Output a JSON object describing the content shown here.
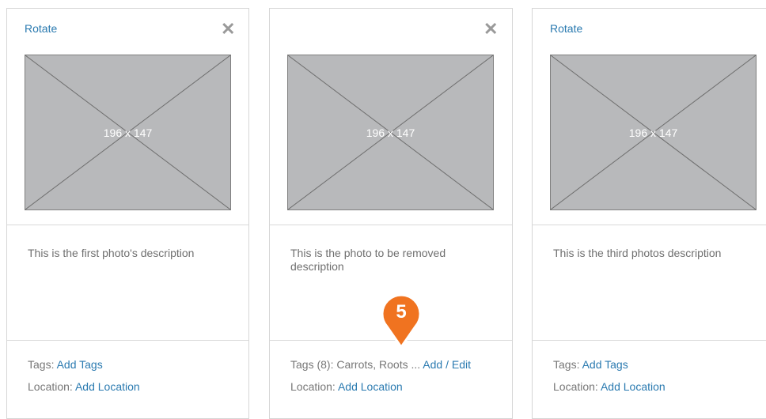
{
  "cards": [
    {
      "rotate_label": "Rotate",
      "close_glyph": "✕",
      "photo_label": "196 x 147",
      "description": "This is the first photo's description",
      "tags_label": "Tags:",
      "tags_link": "Add Tags",
      "location_label": "Location:",
      "location_link": "Add Location"
    },
    {
      "close_glyph": "✕",
      "photo_label": "196 x 147",
      "description": "This is the photo to be removed description",
      "tags_label": "Tags (8): Carrots, Roots ...",
      "tags_link": "Add / Edit",
      "location_label": "Location:",
      "location_link": "Add Location"
    },
    {
      "rotate_label": "Rotate",
      "photo_label": "196 x 147",
      "description": "This is the third photos description",
      "tags_label": "Tags:",
      "tags_link": "Add Tags",
      "location_label": "Location:",
      "location_link": "Add Location"
    }
  ],
  "annotation_marker": {
    "label": "5",
    "color": "#f07320"
  },
  "colors": {
    "link": "#2a7ab0",
    "placeholder": "#b8b9bb",
    "border": "#d6d6d6"
  },
  "icons": {
    "close": "close-icon",
    "marker": "annotation-marker-icon"
  }
}
